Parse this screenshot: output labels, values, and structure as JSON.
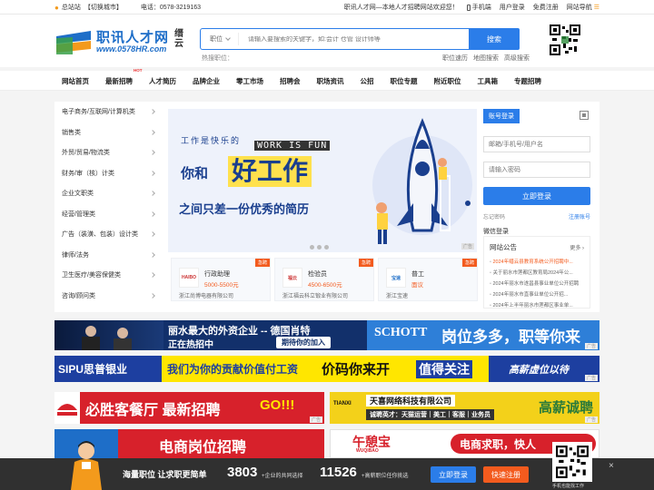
{
  "topbar": {
    "site": "总站站",
    "switch_city": "【切换城市】",
    "phone": "电话：0578-3219163",
    "slogan": "职讯人才网—本地人才招聘网站欢迎您！",
    "mobile": "手机端",
    "login": "用户登录",
    "register": "免费注册",
    "site_nav": "网站导航"
  },
  "header": {
    "logo_text": "职讯人才网",
    "logo_url": "www.0578HR.com",
    "logo_city": "缙云",
    "search_select": "职位",
    "search_placeholder": "请输入要搜索的关键字，如:会计 仓管 设计师等",
    "search_button": "搜索",
    "hot_label": "热搜职位：",
    "sublinks": [
      "职位速历",
      "地图搜索",
      "高级搜索"
    ]
  },
  "nav": {
    "hot_tag": "HOT",
    "items": [
      "网站首页",
      "最新招聘",
      "人才简历",
      "品牌企业",
      "零工市场",
      "招聘会",
      "职场资讯",
      "公招",
      "职位专题",
      "附近职位",
      "工具箱",
      "专题招聘"
    ]
  },
  "categories": [
    "电子商务/互联网/计算机类",
    "销售类",
    "外贸/贸易/物流类",
    "财务/审（核）计类",
    "企业文职类",
    "经营/管理类",
    "广告（装潢、包装）设计类",
    "律师/法务",
    "卫生医疗/美容保健类",
    "咨询/顾问类"
  ],
  "banner": {
    "line1": "工作是快乐的",
    "line2": "WORK IS FUN",
    "line3": "你和",
    "line4": "好工作",
    "line5": "之间只差一份优秀的简历",
    "ad": "广告"
  },
  "jobcards": [
    {
      "title": "行政助理",
      "salary": "5000-5500元",
      "company": "浙江尚博电器有限公司",
      "tag": "急聘",
      "logo": "HAIBO"
    },
    {
      "title": "检验员",
      "salary": "4500-6500元",
      "company": "浙江福云科立锻业有限公司",
      "tag": "急聘",
      "logo": "福云"
    },
    {
      "title": "普工",
      "salary": "面议",
      "company": "浙江宝速",
      "tag": "急聘",
      "logo": "宝速"
    }
  ],
  "login": {
    "tab": "账号登录",
    "user_placeholder": "邮箱/手机号/用户名",
    "pwd_placeholder": "请输入密码",
    "button": "立即登录",
    "forgot": "忘记密码",
    "register": "注册账号",
    "wechat": "微信登录"
  },
  "notice": {
    "title": "网站公告",
    "more": "更多",
    "items": [
      "2024年缙云县教育系统公开招聘中...",
      "关于丽水市莲都区教育局2024年公...",
      "2024年丽水市遂昌县事业单位公开招聘",
      "2024年丽水市直事业单位公开招...",
      "2024年上半年丽水市莲都区事业单..."
    ]
  },
  "ads": {
    "schott_1": "丽水最大的外资企业 -- 德国肖特",
    "schott_2": "正在热招中",
    "schott_3": "期待你的加入",
    "schott_logo": "SCHOTT",
    "schott_sub": "岗位多多，职等你来",
    "sipu_logo": "SIPU思普银业",
    "sipu_1": "我们为你的贡献价值付工资",
    "sipu_2": "价码你来开",
    "sipu_3": "值得关注",
    "sipu_4": "高薪虚位以待",
    "pizza_1": "必胜客餐厅 最新招聘",
    "pizza_2": "GO!!!",
    "tianxi_1": "天喜网络科技有限公司",
    "tianxi_2": "诚聘英才：天猫运营｜美工｜客服｜业务员",
    "tianxi_3": "高薪诚聘",
    "tianxi_logo": "TIANXI",
    "ds_1": "电商岗位招聘",
    "wuqi_logo": "午憩宝",
    "wuqi_sub": "WUQIBAO",
    "wuqi_1": "电商求职，快人",
    "ad_label": "广告"
  },
  "floatbar": {
    "slogan": "海量职位 让求职更简单",
    "n1": "3803",
    "l1": "+企业的共同选择",
    "n2": "11526",
    "l2": "+高薪职位任你挑选",
    "login": "立即登录",
    "register": "快速注册",
    "qr_label": "手机也能找工作",
    "close": "×"
  }
}
